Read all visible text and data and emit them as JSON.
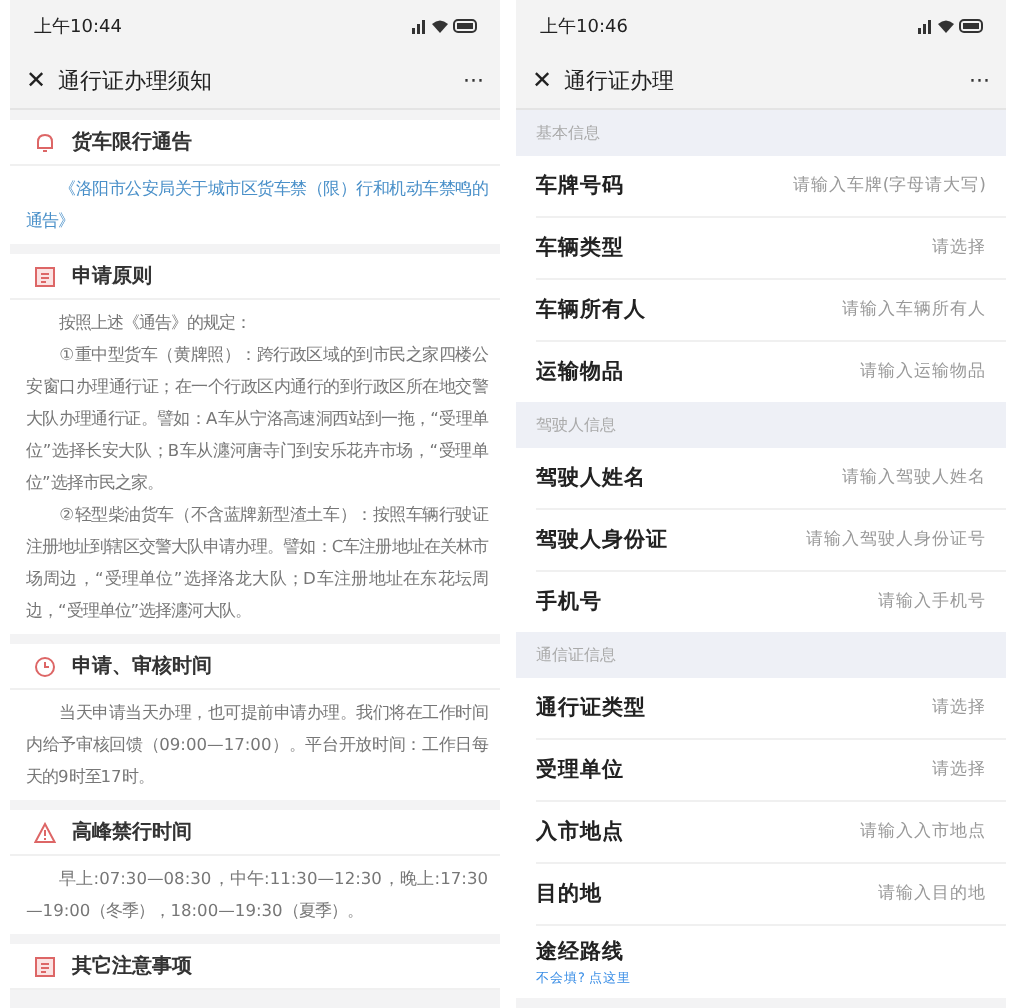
{
  "screens": [
    {
      "status_bar": {
        "time": "上午10:44"
      },
      "nav": {
        "close": "✕",
        "title": "通行证办理须知",
        "more": "···"
      },
      "sections": [
        {
          "kind": "bell",
          "title": "货车限行通告",
          "paragraphs": [
            {
              "kind": "link",
              "text": "《洛阳市公安局关于城市区货车禁（限）行和机动车禁鸣的通告》"
            }
          ]
        },
        {
          "kind": "doc",
          "title": "申请原则",
          "paragraphs": [
            {
              "kind": "text",
              "text": "按照上述《通告》的规定："
            },
            {
              "kind": "text",
              "text": "①重中型货车（黄牌照）：跨行政区域的到市民之家四楼公安窗口办理通行证；在一个行政区内通行的到行政区所在地交警大队办理通行证。譬如：A车从宁洛高速洞西站到一拖，“受理单位”选择长安大队；B车从瀍河唐寺门到安乐花卉市场，“受理单位”选择市民之家。"
            },
            {
              "kind": "text",
              "text": "②轻型柴油货车（不含蓝牌新型渣土车）：按照车辆行驶证注册地址到辖区交警大队申请办理。譬如：C车注册地址在关林市场周边，“受理单位”选择洛龙大队；D车注册地址在东花坛周边，“受理单位”选择瀍河大队。"
            }
          ]
        },
        {
          "kind": "clock",
          "title": "申请、审核时间",
          "paragraphs": [
            {
              "kind": "text",
              "text": "当天申请当天办理，也可提前申请办理。我们将在工作时间内给予审核回馈（09:00—17:00）。平台开放时间：工作日每天的9时至17时。"
            }
          ]
        },
        {
          "kind": "warning",
          "title": "高峰禁行时间",
          "paragraphs": [
            {
              "kind": "text",
              "text": "早上:07:30—08:30，中午:11:30—12:30，晚上:17:30—19:00（冬季），18:00—19:30（夏季）。"
            }
          ]
        },
        {
          "kind": "doc",
          "title": "其它注意事项"
        }
      ]
    },
    {
      "status_bar": {
        "time": "上午10:46"
      },
      "nav": {
        "close": "✕",
        "title": "通行证办理",
        "more": "···"
      },
      "groups": [
        {
          "title": "基本信息",
          "rows": [
            {
              "kind": "input",
              "label": "车牌号码",
              "placeholder": "请输入车牌(字母请大写)"
            },
            {
              "kind": "select",
              "label": "车辆类型",
              "placeholder": "请选择"
            },
            {
              "kind": "input",
              "label": "车辆所有人",
              "placeholder": "请输入车辆所有人"
            },
            {
              "kind": "input",
              "label": "运输物品",
              "placeholder": "请输入运输物品"
            }
          ]
        },
        {
          "title": "驾驶人信息",
          "rows": [
            {
              "kind": "input",
              "label": "驾驶人姓名",
              "placeholder": "请输入驾驶人姓名"
            },
            {
              "kind": "input",
              "label": "驾驶人身份证",
              "placeholder": "请输入驾驶人身份证号"
            },
            {
              "kind": "input",
              "label": "手机号",
              "placeholder": "请输入手机号"
            }
          ]
        },
        {
          "title": "通信证信息",
          "rows": [
            {
              "kind": "select",
              "label": "通行证类型",
              "placeholder": "请选择"
            },
            {
              "kind": "select",
              "label": "受理单位",
              "placeholder": "请选择"
            },
            {
              "kind": "input",
              "label": "入市地点",
              "placeholder": "请输入入市地点"
            },
            {
              "kind": "input",
              "label": "目的地",
              "placeholder": "请输入目的地"
            },
            {
              "kind": "route",
              "label": "途经路线",
              "help": "不会填? 点这里"
            }
          ]
        }
      ]
    }
  ]
}
